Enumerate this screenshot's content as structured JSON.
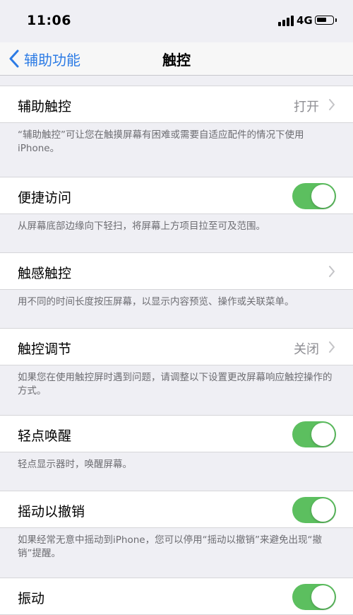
{
  "status_bar": {
    "time": "11:06",
    "network": "4G"
  },
  "nav": {
    "back_label": "辅助功能",
    "title": "触控"
  },
  "cells": [
    {
      "label": "辅助触控",
      "value": "打开",
      "type": "disclosure",
      "footer": "“辅助触控”可让您在触摸屏幕有困难或需要自适应配件的情况下使用iPhone。"
    },
    {
      "label": "便捷访问",
      "type": "toggle",
      "on": true,
      "footer": "从屏幕底部边缘向下轻扫，将屏幕上方项目拉至可及范围。"
    },
    {
      "label": "触感触控",
      "value": "",
      "type": "disclosure",
      "footer": "用不同的时间长度按压屏幕，以显示内容预览、操作或关联菜单。"
    },
    {
      "label": "触控调节",
      "value": "关闭",
      "type": "disclosure",
      "footer": "如果您在使用触控屏时遇到问题，请调整以下设置更改屏幕响应触控操作的方式。"
    },
    {
      "label": "轻点唤醒",
      "type": "toggle",
      "on": true,
      "footer": "轻点显示器时，唤醒屏幕。"
    },
    {
      "label": "摇动以撤销",
      "type": "toggle",
      "on": true,
      "footer": "如果经常无意中摇动到iPhone，您可以停用“摇动以撤销”来避免出现“撤销”提醒。"
    },
    {
      "label": "振动",
      "type": "toggle",
      "on": true,
      "footer": ""
    }
  ],
  "colors": {
    "accent": "#2c7be5",
    "toggle_on": "#5cbf5f",
    "background": "#efeff4"
  }
}
